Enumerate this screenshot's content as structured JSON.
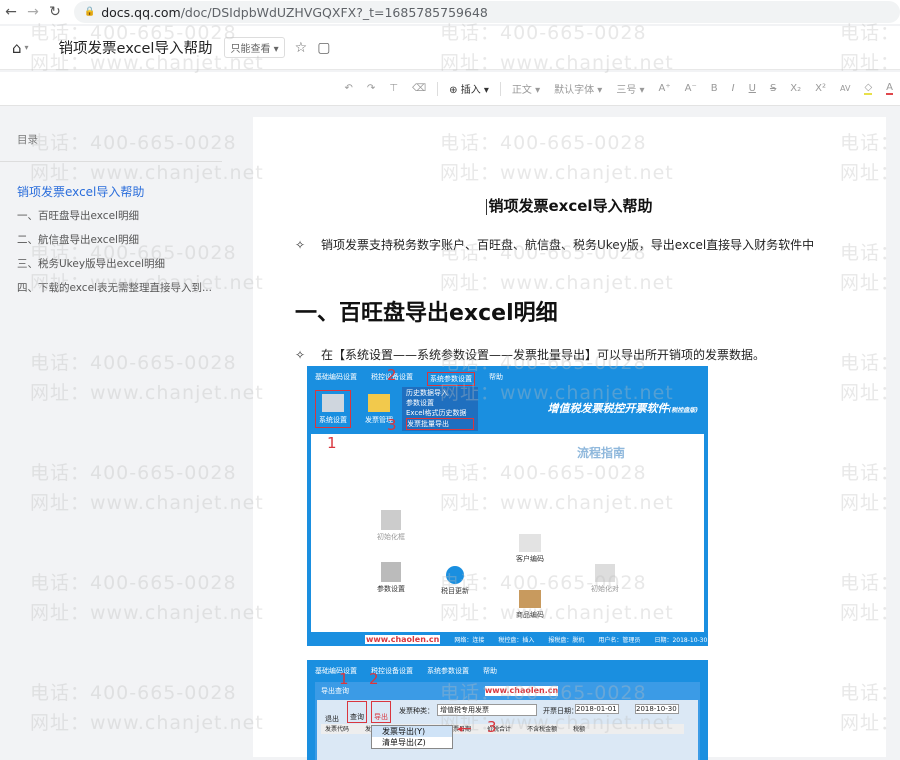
{
  "browser": {
    "url_host": "docs.qq.com",
    "url_path": "/doc/DSIdpbWdUZHVGQXFX?_t=1685785759648"
  },
  "header": {
    "doc_title": "销项发票excel导入帮助",
    "permission": "只能查看"
  },
  "toolbar": {
    "insert": "插入",
    "style": "正文",
    "font": "默认字体",
    "size": "三号",
    "bold": "B",
    "italic": "I",
    "underline": "U",
    "strike": "S",
    "sub": "X₂",
    "sup": "X²",
    "spacing": "AV",
    "text_color": "A"
  },
  "sidebar": {
    "label": "目录",
    "items": [
      {
        "label": "销项发票excel导入帮助"
      },
      {
        "label": "一、百旺盘导出excel明细"
      },
      {
        "label": "二、航信盘导出excel明细"
      },
      {
        "label": "三、税务Ukey版导出excel明细"
      },
      {
        "label": "四、下载的excel表无需整理直接导入到..."
      }
    ]
  },
  "doc": {
    "title": "销项发票excel导入帮助",
    "bullet1": "销项发票支持税务数字账户、百旺盘、航信盘、税务Ukey版，导出excel直接导入财务软件中",
    "heading1": "一、百旺盘导出excel明细",
    "bullet2": "在【系统设置——系统参数设置——发票批量导出】可以导出所开销项的发票数据。"
  },
  "shot1": {
    "menu": [
      "基础编码设置",
      "税控设备设置",
      "系统参数设置",
      "帮助"
    ],
    "dropdown": [
      "历史数据导入",
      "参数设置",
      "Excel格式历史数据",
      "发票批量导出"
    ],
    "icons": [
      "系统设置",
      "发票管理"
    ],
    "app_title": "增值税发票税控开票软件",
    "app_sub": "(税控盘版)",
    "guide": "流程指南",
    "flow": [
      "初始化框",
      "参数设置",
      "税目更新",
      "客户编码",
      "商品编码",
      "初始化对"
    ],
    "status": [
      "www.chaolen.cn",
      "网络：连接",
      "税控盘：插入",
      "报税盘：脱机",
      "用户名：管理员",
      "日期：2018-10-30"
    ],
    "marks": [
      "1",
      "2",
      "3"
    ]
  },
  "shot2": {
    "menu": [
      "基础编码设置",
      "税控设备设置",
      "系统参数设置",
      "帮助"
    ],
    "window": "导出查询",
    "site": "www.chaolen.cn",
    "buttons": [
      "退出",
      "查询",
      "导出"
    ],
    "type_label": "发票种类：",
    "type_value": "增值税专用发票",
    "date_label": "开票日期：",
    "date_from": "2018-01-01",
    "date_to": "2018-10-30",
    "cols": [
      "发票代码",
      "发",
      "开票日期",
      "价税合计",
      "不含税金额",
      "税额"
    ],
    "menu_items": [
      "发票导出(Y)",
      "清单导出(Z)"
    ],
    "marks": [
      "1",
      "2",
      "3"
    ]
  },
  "watermark": {
    "phone": "电话：400-665-0028",
    "site": "网址：www.chanjet.net"
  }
}
